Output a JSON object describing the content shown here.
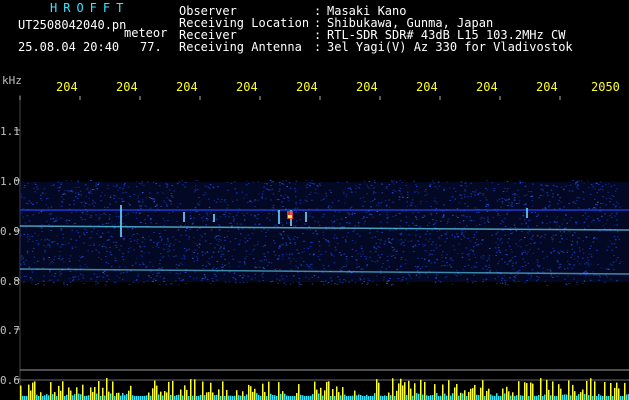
{
  "header": {
    "brand": "HROFFT",
    "filename": "UT2508042040.pn",
    "mode": "meteor",
    "timestamp": "25.08.04 20:40",
    "number": "77."
  },
  "info": [
    {
      "label": "Observer",
      "value": "Masaki Kano"
    },
    {
      "label": "Receiving Location",
      "value": "Shibukawa, Gunma, Japan"
    },
    {
      "label": "Receiver",
      "value": "RTL-SDR SDR# 43dB L15 103.2MHz CW"
    },
    {
      "label": "Receiving Antenna",
      "value": "3el Yagi(V) Az 330 for Vladivostok"
    }
  ],
  "axis": {
    "y_unit": "kHz",
    "y_ticks": [
      "1.1",
      "1.0",
      "0.9",
      "0.8",
      "0.7",
      "0.6"
    ],
    "x_ticks": [
      "204",
      "204",
      "204",
      "204",
      "204",
      "204",
      "204",
      "204",
      "204",
      "2050"
    ]
  },
  "colors": {
    "background": "#000000",
    "header_text": "#ffffff",
    "brand_text": "#33e6ff",
    "tick_text": "#ffff22",
    "signal": "#1e4cff",
    "signal_bright": "#66ddff"
  }
}
